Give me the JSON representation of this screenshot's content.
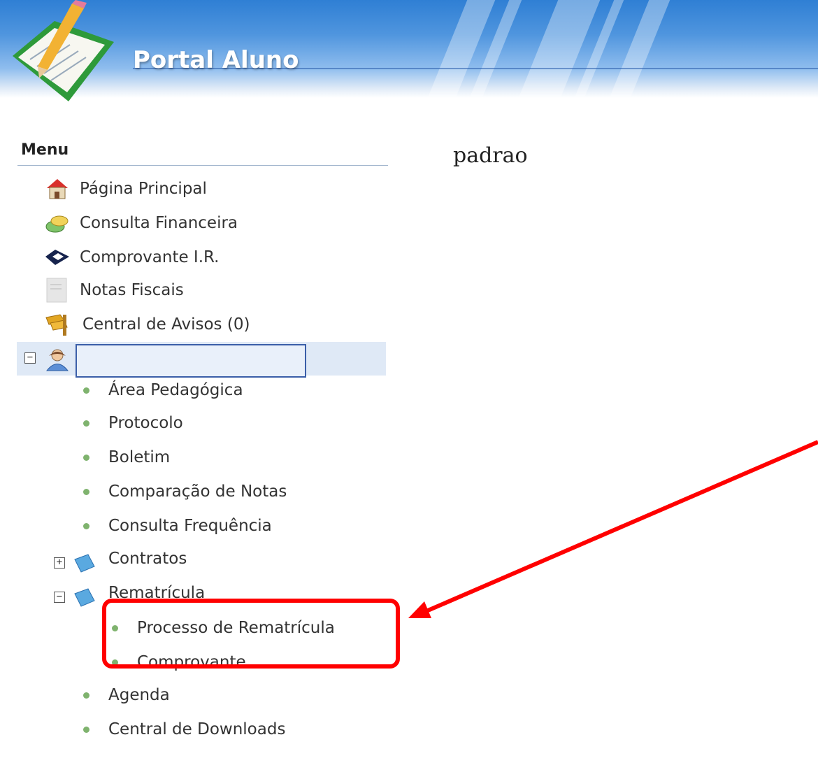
{
  "header": {
    "title": "Portal Aluno"
  },
  "menu": {
    "title": "Menu",
    "top_items": [
      {
        "label": "Página Principal",
        "icon": "home-icon"
      },
      {
        "label": "Consulta Financeira",
        "icon": "money-icon"
      },
      {
        "label": "Comprovante I.R.",
        "icon": "receita-icon"
      },
      {
        "label": "Notas Fiscais",
        "icon": "document-icon"
      },
      {
        "label": "Central de Avisos (0)",
        "icon": "flag-icon"
      }
    ],
    "student": {
      "name": "",
      "icon": "user-icon"
    },
    "student_items": [
      {
        "label": "Área Pedagógica"
      },
      {
        "label": "Protocolo"
      },
      {
        "label": "Boletim"
      },
      {
        "label": "Comparação de Notas"
      },
      {
        "label": "Consulta Frequência"
      }
    ],
    "contratos": {
      "label": "Contratos"
    },
    "rematricula": {
      "label": "Rematrícula",
      "children": [
        {
          "label": "Processo de Rematrícula"
        },
        {
          "label": "Comprovante"
        }
      ]
    },
    "bottom_items": [
      {
        "label": "Agenda"
      },
      {
        "label": "Central de Downloads"
      }
    ]
  },
  "content": {
    "text": "padrao"
  },
  "colors": {
    "highlight": "#ff0000",
    "bullet": "#7fb36e",
    "selected_bg": "#dfe9f6"
  }
}
